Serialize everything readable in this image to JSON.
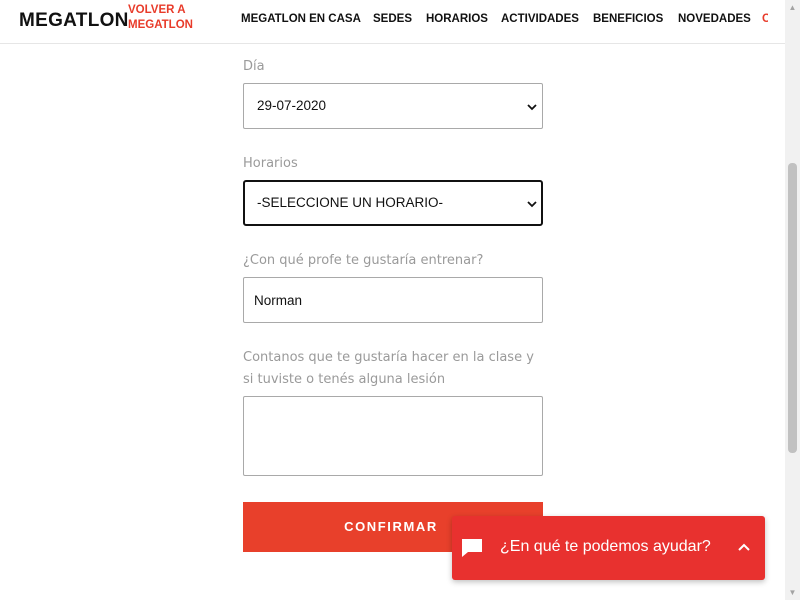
{
  "header": {
    "logo": "MEGATLON",
    "back_link": "VOLVER A MEGATLON",
    "nav": [
      {
        "label": "MEGATLON EN CASA"
      },
      {
        "label": "SEDES"
      },
      {
        "label": "HORARIOS"
      },
      {
        "label": "ACTIVIDADES"
      },
      {
        "label": "BENEFICIOS"
      },
      {
        "label": "NOVEDADES"
      }
    ]
  },
  "form": {
    "dia": {
      "label": "Día",
      "value": "29-07-2020"
    },
    "horarios": {
      "label": "Horarios",
      "value": "-SELECCIONE UN HORARIO-"
    },
    "profe": {
      "label": "¿Con qué profe te gustaría entrenar?",
      "value": "Norman"
    },
    "comentario": {
      "label": "Contanos que te gustaría hacer en la clase y si tuviste o tenés alguna lesión",
      "value": ""
    },
    "confirm_label": "CONFIRMAR"
  },
  "chat": {
    "prompt": "¿En qué te podemos ayudar?",
    "icon": "chat-bubble-icon",
    "toggle_icon": "chevron-up-icon"
  },
  "colors": {
    "accent": "#e8402b",
    "chat_bg": "#e8312f",
    "label_gray": "#9a9a9a"
  }
}
